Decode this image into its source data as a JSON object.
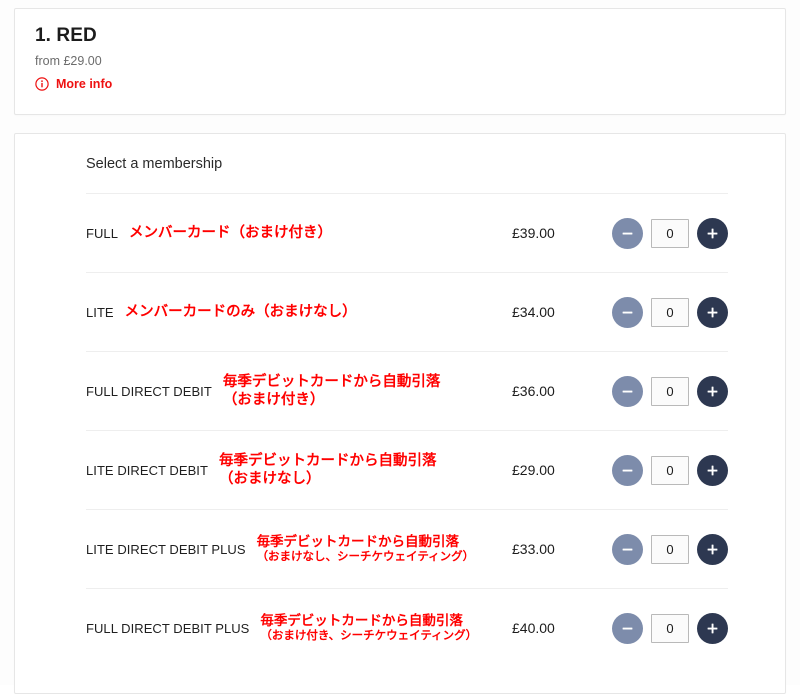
{
  "product": {
    "title": "1. RED",
    "from_price": "from £29.00",
    "more_info_label": "More info",
    "info_icon": "info-circle-icon",
    "accent_color": "#ee1111"
  },
  "membership": {
    "section_title": "Select a membership",
    "colors": {
      "desc_red": "#ff0000",
      "minus_button": "#7d8cab",
      "plus_button": "#2d3851",
      "divider": "#eeeeee",
      "card_border": "#e6e6e6"
    },
    "stepper": {
      "minus_icon": "minus-icon",
      "plus_icon": "plus-icon",
      "default_quantity": "0"
    },
    "rows": [
      {
        "code": "FULL",
        "desc_line1": "メンバーカード（おまけ付き）",
        "desc_line2": "",
        "compact": false,
        "price": "£39.00",
        "quantity": "0"
      },
      {
        "code": "LITE",
        "desc_line1": "メンバーカードのみ（おまけなし）",
        "desc_line2": "",
        "compact": false,
        "price": "£34.00",
        "quantity": "0"
      },
      {
        "code": "FULL DIRECT DEBIT",
        "desc_line1": "毎季デビットカードから自動引落",
        "desc_line2": "（おまけ付き）",
        "compact": false,
        "price": "£36.00",
        "quantity": "0"
      },
      {
        "code": "LITE DIRECT DEBIT",
        "desc_line1": "毎季デビットカードから自動引落",
        "desc_line2": "（おまけなし）",
        "compact": false,
        "price": "£29.00",
        "quantity": "0"
      },
      {
        "code": "LITE DIRECT DEBIT PLUS",
        "desc_line1": "毎季デビットカードから自動引落",
        "desc_line2": "（おまけなし、シーチケウェイティング）",
        "compact": true,
        "price": "£33.00",
        "quantity": "0"
      },
      {
        "code": "FULL DIRECT DEBIT PLUS",
        "desc_line1": "毎季デビットカードから自動引落",
        "desc_line2": "（おまけ付き、シーチケウェイティング）",
        "compact": true,
        "price": "£40.00",
        "quantity": "0"
      }
    ]
  }
}
